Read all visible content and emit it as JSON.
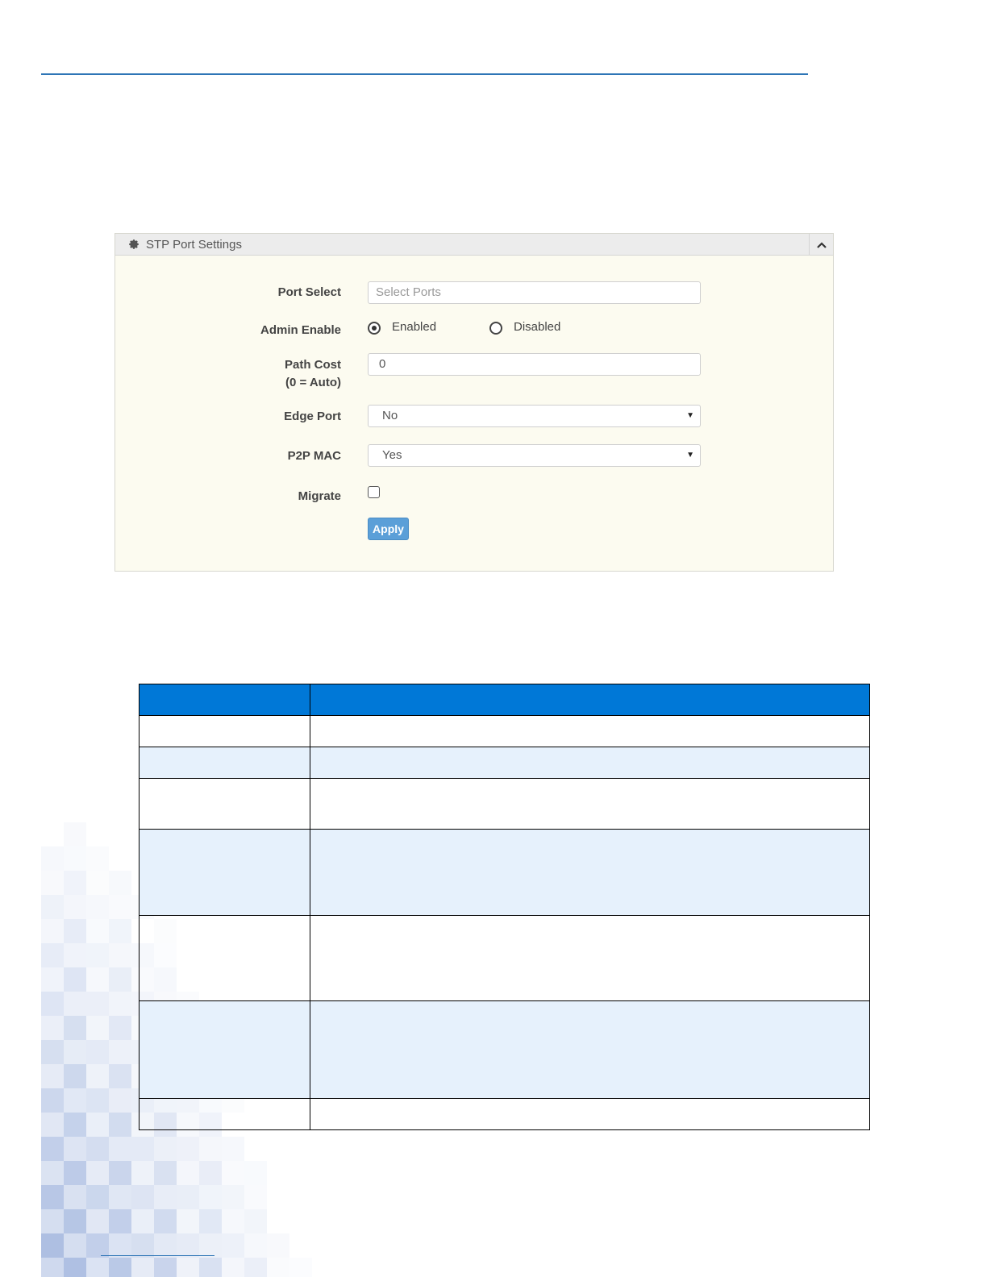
{
  "panel": {
    "title": "STP Port Settings",
    "port_select": {
      "label": "Port Select",
      "placeholder": "Select Ports"
    },
    "admin_enable": {
      "label": "Admin Enable",
      "options": [
        "Enabled",
        "Disabled"
      ],
      "selected": "Enabled"
    },
    "path_cost": {
      "label_line1": "Path Cost",
      "label_line2": "(0 = Auto)",
      "value": "0"
    },
    "edge_port": {
      "label": "Edge Port",
      "value": "No"
    },
    "p2p_mac": {
      "label": "P2P MAC",
      "value": "Yes"
    },
    "migrate": {
      "label": "Migrate",
      "checked": false
    },
    "apply_label": "Apply"
  },
  "table": {
    "header_color": "#0078d7",
    "alt_row_color": "#e6f1fc",
    "row_count": 7
  },
  "colors": {
    "rule": "#2e75b6",
    "panel_bg": "#fcfbf0",
    "apply_bg": "#5b9fd8"
  },
  "icons": [
    "gear-icon",
    "chevron-up-icon",
    "select-caret-icon"
  ]
}
